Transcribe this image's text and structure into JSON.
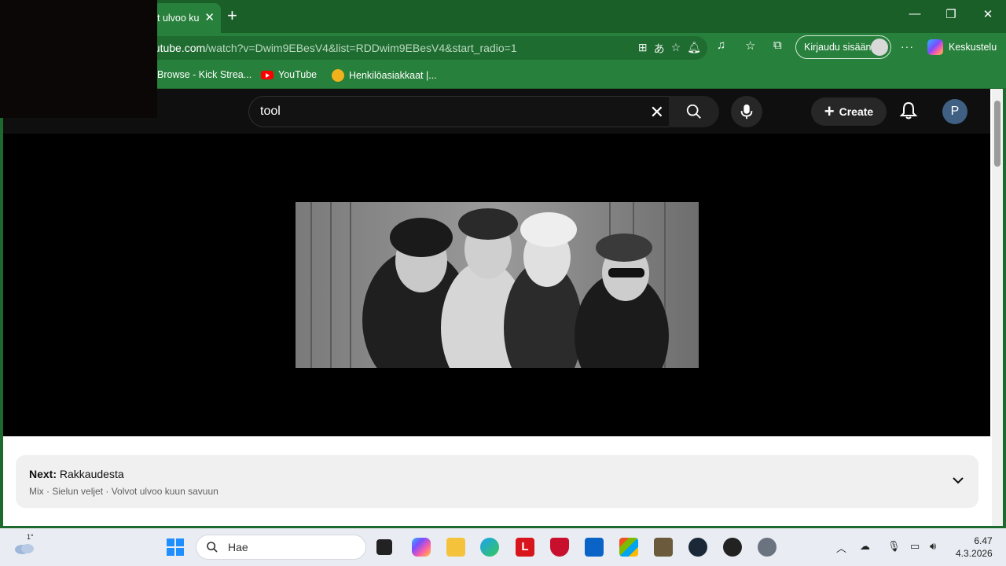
{
  "browser": {
    "tab_title": "t ulvoo ku",
    "url_host": "outube.com",
    "url_path": "/watch?v=Dwim9EBesV4&list=RDDwim9EBesV4&start_radio=1",
    "signin_label": "Kirjaudu sisään",
    "copilot_label": "Keskustelu",
    "bookmarks": [
      {
        "label": "Browse - Kick Strea..."
      },
      {
        "label": "YouTube"
      },
      {
        "label": "Henkilöasiakkaat |..."
      }
    ]
  },
  "youtube": {
    "search_value": "tool",
    "create_label": "Create",
    "avatar_letter": "P",
    "next": {
      "prefix": "Next:",
      "title": "Rakkaudesta",
      "subtitle": "Mix · Sielun veljet · Volvot ulvoo kuun savuun"
    }
  },
  "taskbar": {
    "weather_temp": "1°",
    "search_placeholder": "Hae",
    "time": "6.47",
    "date": "4.3.2026"
  },
  "colors": {
    "browser_green": "#27803b",
    "youtube_dark": "#0f0f0f",
    "accent_red": "#ff0000"
  }
}
